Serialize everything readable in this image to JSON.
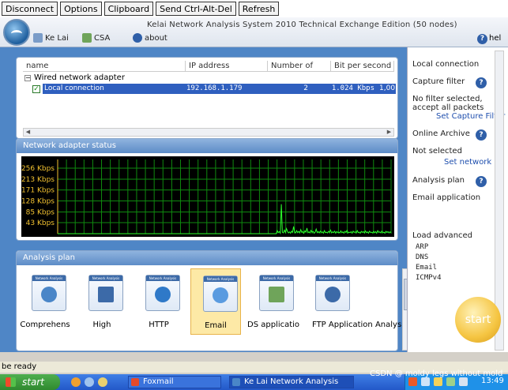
{
  "vnc_toolbar": {
    "buttons": [
      "Disconnect",
      "Options",
      "Clipboard",
      "Send Ctrl-Alt-Del",
      "Refresh"
    ]
  },
  "app": {
    "title": "Kelai Network Analysis System 2010 Technical Exchange Edition (50 nodes)",
    "menu": {
      "kelai": "Ke Lai",
      "csa": "CSA",
      "about": "about",
      "help": "hel"
    }
  },
  "adapter_table": {
    "columns": [
      "name",
      "IP address",
      "Number of",
      "Bit per second"
    ],
    "group": "Wired network adapter",
    "row": {
      "name": "Local connection",
      "ip": "192.168.1.179",
      "number": "2",
      "bps": "1.024 Kbps",
      "extra": "1,00"
    }
  },
  "status_panel": {
    "title": "Network adapter status",
    "y_ticks": [
      "256 Kbps",
      "213 Kbps",
      "171 Kbps",
      "128 Kbps",
      "85 Kbps",
      "43 Kbps"
    ]
  },
  "plan_panel": {
    "title": "Analysis plan",
    "cards": [
      {
        "label": "Comprehens"
      },
      {
        "label": "High"
      },
      {
        "label": "HTTP"
      },
      {
        "label": "Email"
      },
      {
        "label": "DS applicatio"
      },
      {
        "label": "FTP Application Analysis"
      }
    ]
  },
  "right_pane": {
    "local_connection": "Local connection",
    "capture_filter_label": "Capture filter",
    "capture_filter_value": "No filter selected, accept all packets",
    "set_capture_filter": "Set Capture Filter",
    "online_archive_label": "Online Archive",
    "online_archive_value": "Not selected",
    "set_network": "Set network",
    "analysis_plan_label": "Analysis plan",
    "analysis_plan_value": "Email application",
    "load_modules": "Load advanced",
    "modules": [
      "ARP",
      "DNS",
      "Email",
      "ICMPv4"
    ],
    "start": "start"
  },
  "status_line": "be ready",
  "watermark": "CSDN @ moldy legs without mold",
  "taskbar": {
    "start": "start",
    "tasks": [
      "Foxmail",
      "Ke Lai Network Analysis"
    ],
    "clock": "13:49"
  },
  "chart_data": {
    "type": "line",
    "title": "Network adapter status",
    "yticks": [
      "256 Kbps",
      "213 Kbps",
      "171 Kbps",
      "128 Kbps",
      "85 Kbps",
      "43 Kbps"
    ],
    "ylim": [
      0,
      290
    ],
    "series": [
      {
        "values": [
          0,
          0,
          0,
          0,
          0,
          0,
          0,
          0,
          0,
          0,
          0,
          0,
          0,
          0,
          0,
          0,
          0,
          0,
          0,
          0,
          0,
          0,
          0,
          0,
          0,
          0,
          0,
          0,
          0,
          0,
          0,
          0,
          0,
          0,
          0,
          0,
          0,
          0,
          0,
          0,
          0,
          0,
          0,
          0,
          0,
          0,
          0,
          0,
          0,
          0,
          0,
          0,
          0,
          0,
          0,
          0,
          0,
          0,
          0,
          0,
          0,
          0,
          0,
          0,
          0,
          0,
          0,
          0,
          0,
          0,
          0,
          0,
          0,
          0,
          0,
          0,
          0,
          0,
          0,
          0,
          0,
          0,
          0,
          0,
          0,
          0,
          0,
          0,
          0,
          0,
          0,
          0,
          0,
          0,
          0,
          0,
          0,
          0,
          0,
          0,
          0,
          0,
          0,
          0,
          0,
          0,
          0,
          0,
          0,
          0,
          0,
          0,
          0,
          0,
          0,
          0,
          0,
          0,
          0,
          0,
          0,
          0,
          0,
          0,
          0,
          0,
          0,
          0,
          0,
          0,
          0,
          0,
          0,
          0,
          0,
          0,
          0,
          0,
          0,
          0,
          0,
          0,
          0,
          0,
          0,
          0,
          0,
          0,
          0,
          0,
          0,
          0,
          0,
          0,
          0,
          0,
          0,
          0,
          0,
          0,
          0,
          0,
          0,
          0,
          0,
          0,
          0,
          0,
          0,
          0,
          0,
          0,
          0,
          0,
          0,
          0,
          0,
          0,
          0,
          0,
          0,
          0,
          0,
          0,
          0,
          0,
          0,
          0,
          0,
          0,
          0,
          0,
          0,
          0,
          0,
          0,
          0,
          0,
          0,
          0,
          0,
          0,
          0,
          0,
          0,
          0,
          0,
          0,
          0,
          0,
          0,
          0,
          0,
          0,
          12,
          4,
          8,
          2,
          115,
          6,
          3,
          14,
          5,
          20,
          9,
          3,
          7,
          2,
          10,
          5,
          28,
          6,
          3,
          12,
          4,
          9,
          3,
          16,
          5,
          8,
          2,
          11,
          6,
          22,
          4,
          7,
          3,
          13,
          5,
          9,
          2,
          6,
          18,
          4,
          8,
          3,
          10,
          5,
          7,
          2,
          12,
          4,
          6,
          3,
          9,
          5,
          14,
          3,
          7,
          4,
          10,
          2,
          8,
          5,
          6,
          3,
          11,
          4,
          7,
          2,
          9,
          5,
          13,
          3,
          6,
          4,
          8,
          2,
          10,
          5,
          7,
          3,
          12,
          4,
          6,
          2,
          9,
          5,
          8,
          3,
          11,
          4,
          7,
          2,
          10,
          5,
          6,
          3,
          9,
          4,
          8,
          2,
          12,
          5,
          7,
          3,
          10,
          4,
          6,
          2,
          9,
          5,
          8,
          3,
          7,
          4
        ]
      }
    ]
  }
}
